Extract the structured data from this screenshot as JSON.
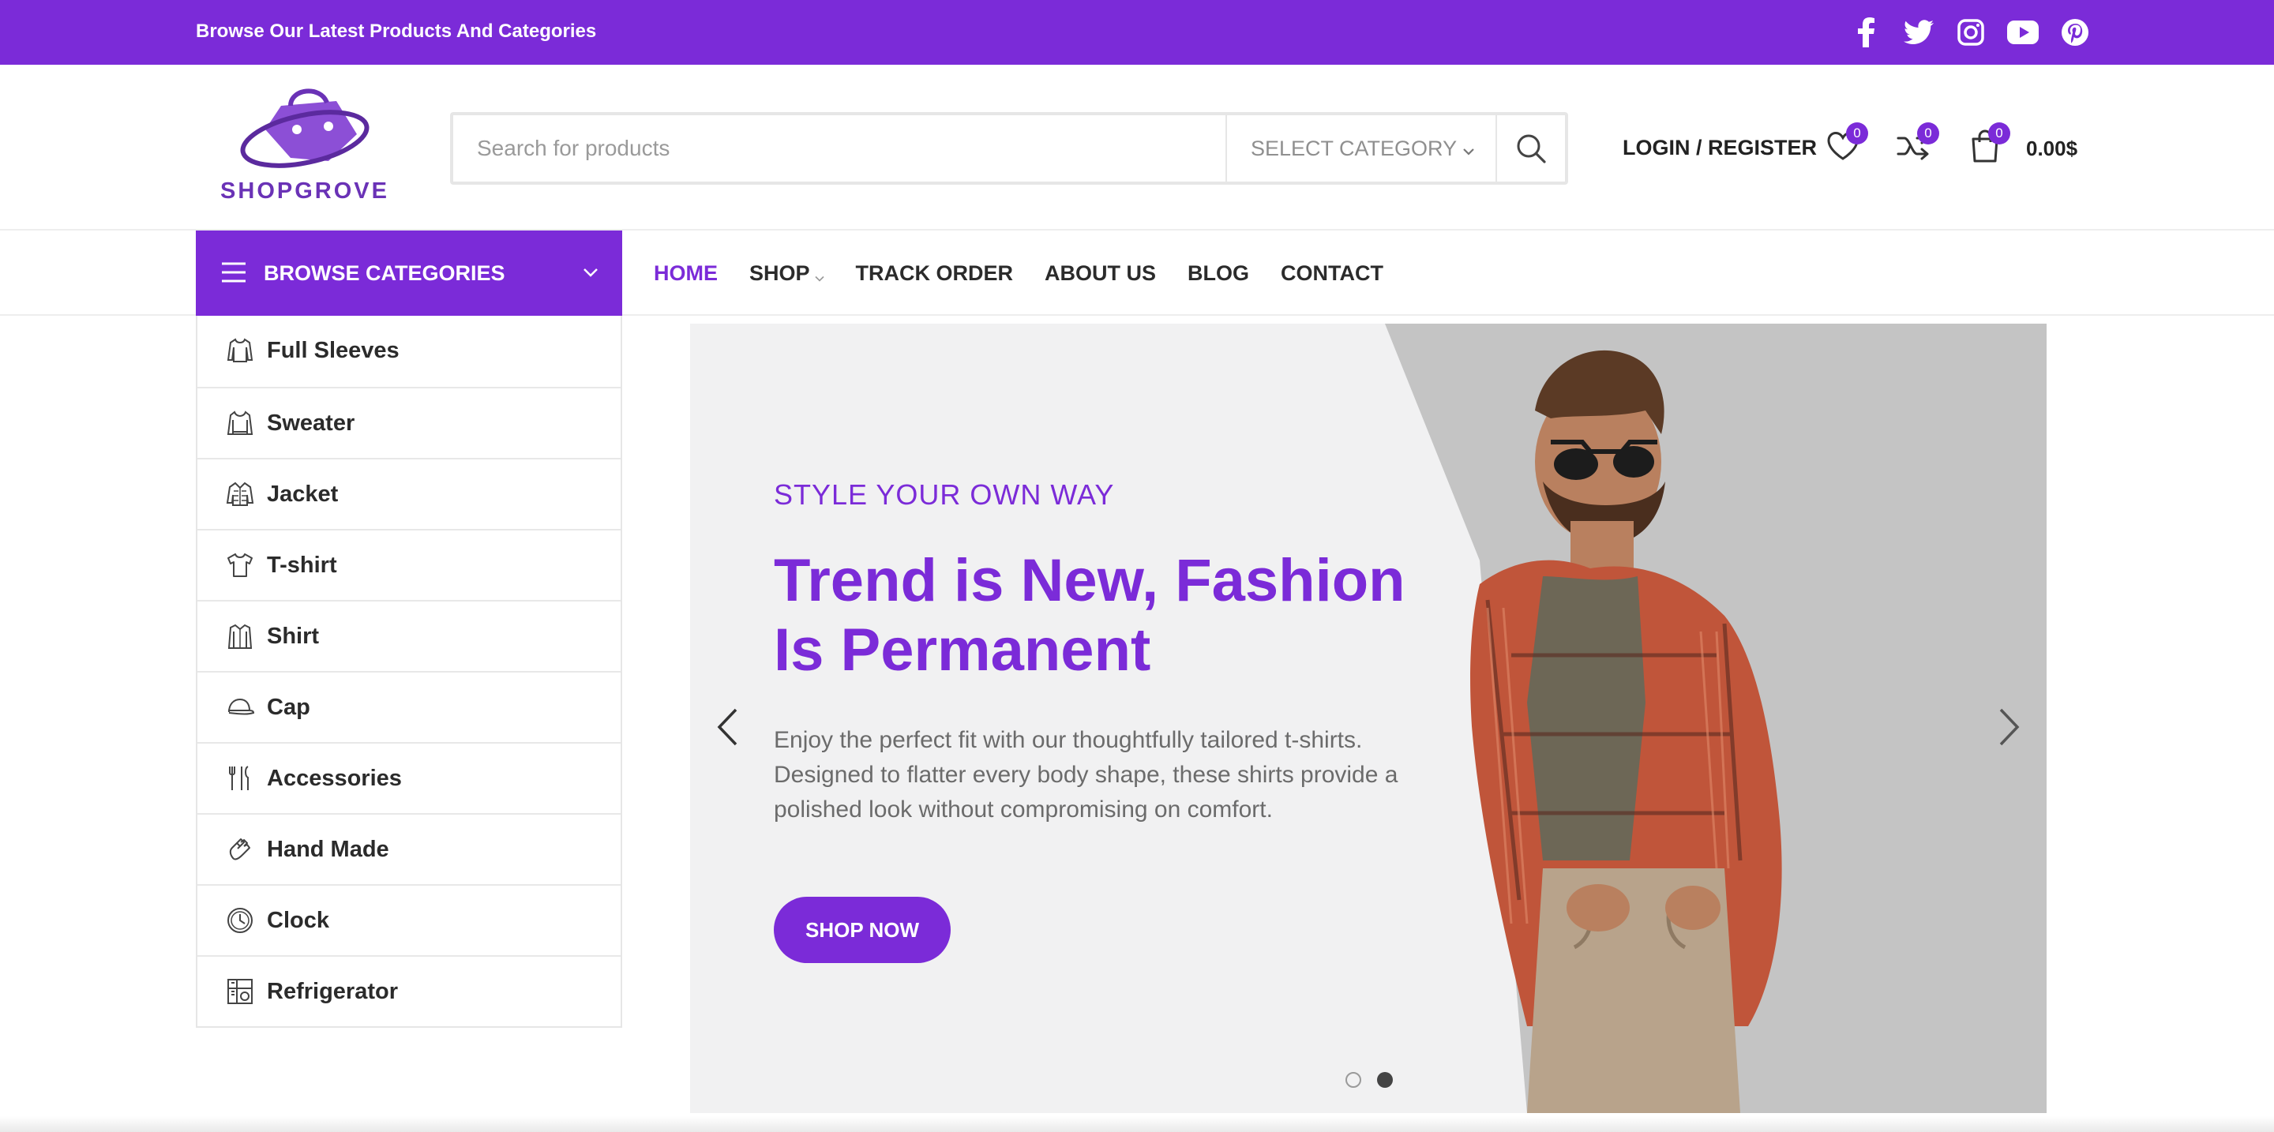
{
  "topbar": {
    "text": "Browse Our Latest Products And Categories",
    "social_icons": [
      "facebook-icon",
      "twitter-icon",
      "instagram-icon",
      "youtube-icon",
      "pinterest-icon"
    ]
  },
  "header": {
    "logo_text": "SHOPGROVE",
    "search": {
      "placeholder": "Search for products",
      "value": "",
      "category_label": "SELECT CATEGORY"
    },
    "login_label": "LOGIN / REGISTER",
    "wishlist_count": "0",
    "compare_count": "0",
    "cart_count": "0",
    "cart_total": "0.00$"
  },
  "nav": {
    "browse_label": "BROWSE CATEGORIES",
    "items": [
      {
        "label": "HOME",
        "active": true
      },
      {
        "label": "SHOP",
        "has_dropdown": true
      },
      {
        "label": "TRACK ORDER"
      },
      {
        "label": "ABOUT US"
      },
      {
        "label": "BLOG"
      },
      {
        "label": "CONTACT"
      }
    ]
  },
  "categories": [
    {
      "label": "Full Sleeves",
      "icon": "full-sleeves-icon"
    },
    {
      "label": "Sweater",
      "icon": "sweater-icon"
    },
    {
      "label": "Jacket",
      "icon": "jacket-icon"
    },
    {
      "label": "T-shirt",
      "icon": "tshirt-icon"
    },
    {
      "label": "Shirt",
      "icon": "shirt-icon"
    },
    {
      "label": "Cap",
      "icon": "cap-icon"
    },
    {
      "label": "Accessories",
      "icon": "accessories-icon"
    },
    {
      "label": "Hand Made",
      "icon": "hand-made-icon"
    },
    {
      "label": "Clock",
      "icon": "clock-icon"
    },
    {
      "label": "Refrigerator",
      "icon": "refrigerator-icon"
    }
  ],
  "hero": {
    "eyebrow": "STYLE YOUR OWN WAY",
    "headline": "Trend is New, Fashion Is Permanent",
    "description": "Enjoy the perfect fit with our thoughtfully tailored t-shirts. Designed to flatter every body shape, these shirts provide a polished look without compromising on comfort.",
    "cta_label": "SHOP NOW",
    "slide_count": 2,
    "active_slide": 2
  },
  "colors": {
    "brand": "#7b2bd8",
    "text_dark": "#2b2b2b",
    "muted": "#6b6b6b",
    "slide_bg": "#f1f1f2"
  }
}
